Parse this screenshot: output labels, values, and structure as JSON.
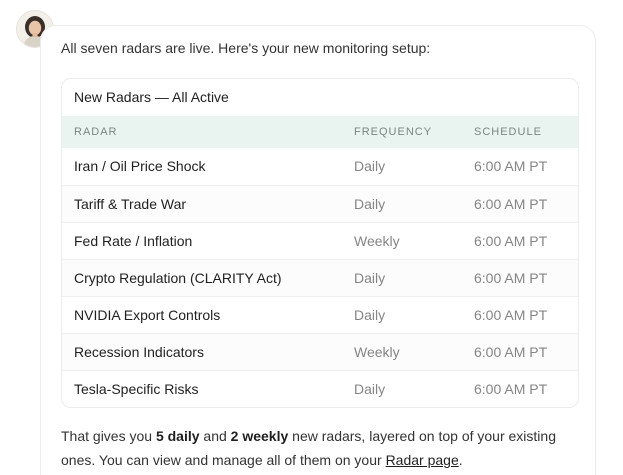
{
  "intro": "All seven radars are live. Here's your new monitoring setup:",
  "card": {
    "title": "New Radars — All Active",
    "columns": [
      "RADAR",
      "FREQUENCY",
      "SCHEDULE"
    ],
    "rows": [
      {
        "radar": "Iran / Oil Price Shock",
        "frequency": "Daily",
        "schedule": "6:00 AM PT"
      },
      {
        "radar": "Tariff & Trade War",
        "frequency": "Daily",
        "schedule": "6:00 AM PT"
      },
      {
        "radar": "Fed Rate / Inflation",
        "frequency": "Weekly",
        "schedule": "6:00 AM PT"
      },
      {
        "radar": "Crypto Regulation (CLARITY Act)",
        "frequency": "Daily",
        "schedule": "6:00 AM PT"
      },
      {
        "radar": "NVIDIA Export Controls",
        "frequency": "Daily",
        "schedule": "6:00 AM PT"
      },
      {
        "radar": "Recession Indicators",
        "frequency": "Weekly",
        "schedule": "6:00 AM PT"
      },
      {
        "radar": "Tesla-Specific Risks",
        "frequency": "Daily",
        "schedule": "6:00 AM PT"
      }
    ]
  },
  "summary": {
    "p1": "That gives you ",
    "b1": "5 daily",
    "p2": " and ",
    "b2": "2 weekly",
    "p3": " new radars, layered on top of your existing ones. You can view and manage all of them on your ",
    "link": "Radar page",
    "p4": "."
  },
  "icons": {
    "avatar": "user-avatar"
  },
  "colors": {
    "header_bg": "#e9f4f1",
    "header_text": "#7b8582",
    "muted_text": "#858585"
  }
}
